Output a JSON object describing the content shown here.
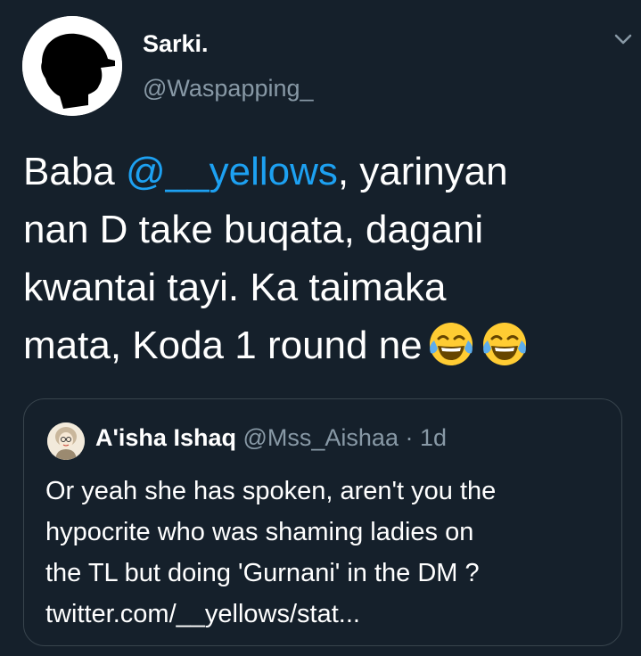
{
  "tweet": {
    "author_name": "Sarki.",
    "author_handle": "@Waspapping_",
    "avatar_icon": "silhouette-cap-avatar",
    "menu_icon": "chevron-down-icon",
    "text_lines": [
      {
        "pre": "Baba ",
        "mention": "@__yellows",
        "post": ", yarinyan"
      },
      "nan D take buqata, dagani",
      "kwantai tayi. Ka taimaka",
      "mata, Koda 1 round ne"
    ],
    "emojis": [
      "face-with-tears-of-joy",
      "face-with-tears-of-joy"
    ]
  },
  "quoted_tweet": {
    "author_name": "A'isha Ishaq",
    "author_handle": "@Mss_Aishaa",
    "time": "· 1d",
    "avatar_icon": "cartoon-girl-avatar",
    "text_lines": [
      "Or yeah she has spoken, aren't you the",
      "hypocrite who was shaming ladies on",
      "the TL but doing 'Gurnani' in the DM ?",
      "twitter.com/__yellows/stat..."
    ]
  },
  "colors": {
    "background": "#15202b",
    "text": "#ffffff",
    "secondary": "#8899a6",
    "link": "#1da1f2",
    "border": "#38444d"
  }
}
